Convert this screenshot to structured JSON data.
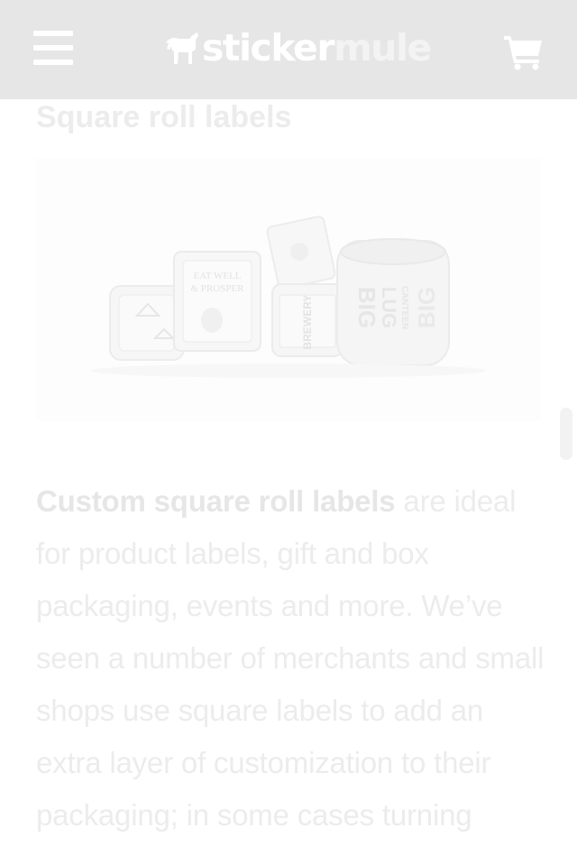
{
  "header": {
    "logo_part1": "sticker",
    "logo_part2": "mule",
    "menu_icon": "hamburger-menu-icon",
    "cart_icon": "shopping-cart-icon",
    "background": "#e6e6e6"
  },
  "section": {
    "title": "Square roll labels",
    "image_alt": "Assorted square roll labels",
    "image_labels": {
      "label1": "EAT WELL",
      "label2": "& PROSPER",
      "label3": "BREWERY",
      "label4": "BIG",
      "label5": "LUG",
      "label6": "CANTEEN"
    }
  },
  "content": {
    "highlight": "Custom square roll labels",
    "paragraph": " are ideal for product labels, gift and box packaging, events and more. We’ve seen a number of merchants and small shops use square labels to add an extra layer of customization to their packaging; in some cases turning"
  }
}
